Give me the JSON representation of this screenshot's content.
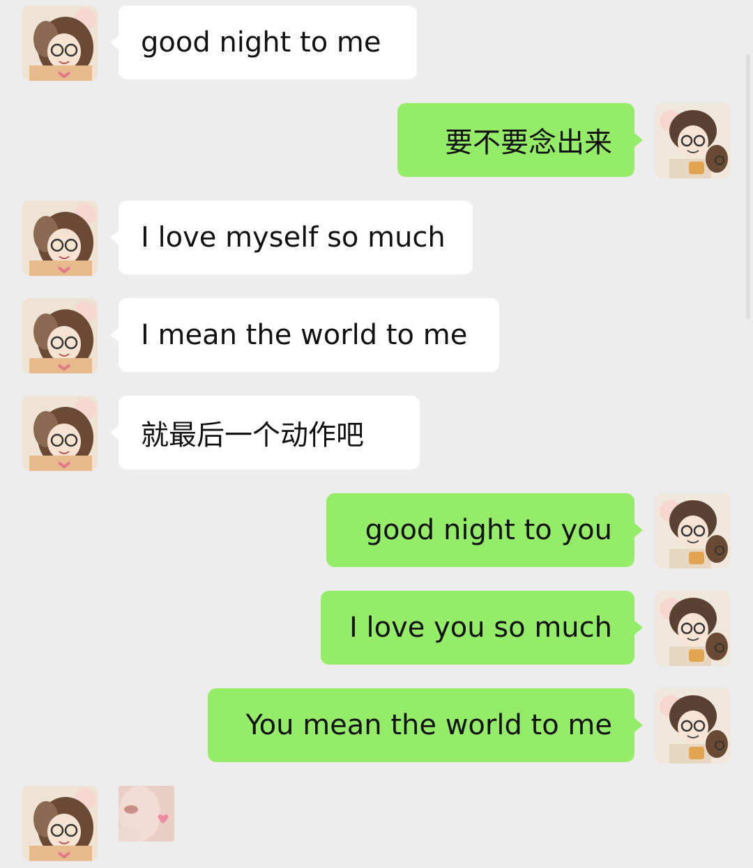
{
  "messages": [
    {
      "side": "in",
      "text": "good night to me"
    },
    {
      "side": "out",
      "text": "要不要念出来"
    },
    {
      "side": "in",
      "text": "I love myself so much"
    },
    {
      "side": "in",
      "text": "I mean the world to me"
    },
    {
      "side": "in",
      "text": "就最后一个动作吧"
    },
    {
      "side": "out",
      "text": "good night to you"
    },
    {
      "side": "out",
      "text": "I love you so much"
    },
    {
      "side": "out",
      "text": "You mean the world to me"
    },
    {
      "side": "in",
      "type": "image"
    }
  ],
  "avatars": {
    "incoming": "cartoon-girl-avatar-icon",
    "outgoing": "cartoon-boy-avatar-icon"
  },
  "colors": {
    "background": "#ededed",
    "incoming_bubble": "#ffffff",
    "outgoing_bubble": "#95ec69"
  }
}
